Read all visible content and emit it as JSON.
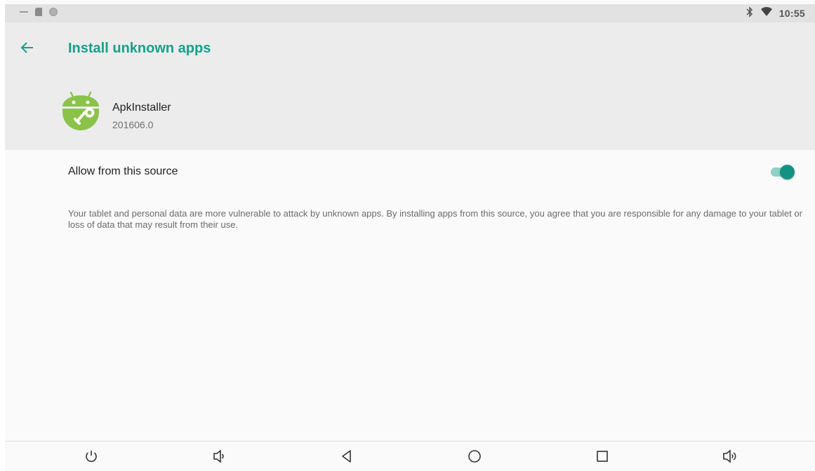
{
  "status_bar": {
    "time": "10:55",
    "left_icons": [
      "minus-icon",
      "sd-card-icon",
      "circle-notification-icon"
    ],
    "right_icons": [
      "bluetooth-icon",
      "wifi-icon"
    ]
  },
  "header": {
    "title": "Install unknown apps",
    "app_name": "ApkInstaller",
    "app_version": "201606.0"
  },
  "setting": {
    "label": "Allow from this source",
    "enabled": true
  },
  "warning": "Your tablet and personal data are more vulnerable to attack by unknown apps. By installing apps from this source, you agree that you are responsible for any damage to your tablet or loss of data that may result from their use.",
  "nav_bar": {
    "buttons": [
      "power-icon",
      "volume-down-icon",
      "back-icon",
      "home-icon",
      "recents-icon",
      "volume-up-icon"
    ]
  },
  "colors": {
    "accent": "#16a08a",
    "toggle_thumb": "#139284",
    "toggle_track": "#8ed1c6",
    "android_green": "#8bc34a"
  }
}
